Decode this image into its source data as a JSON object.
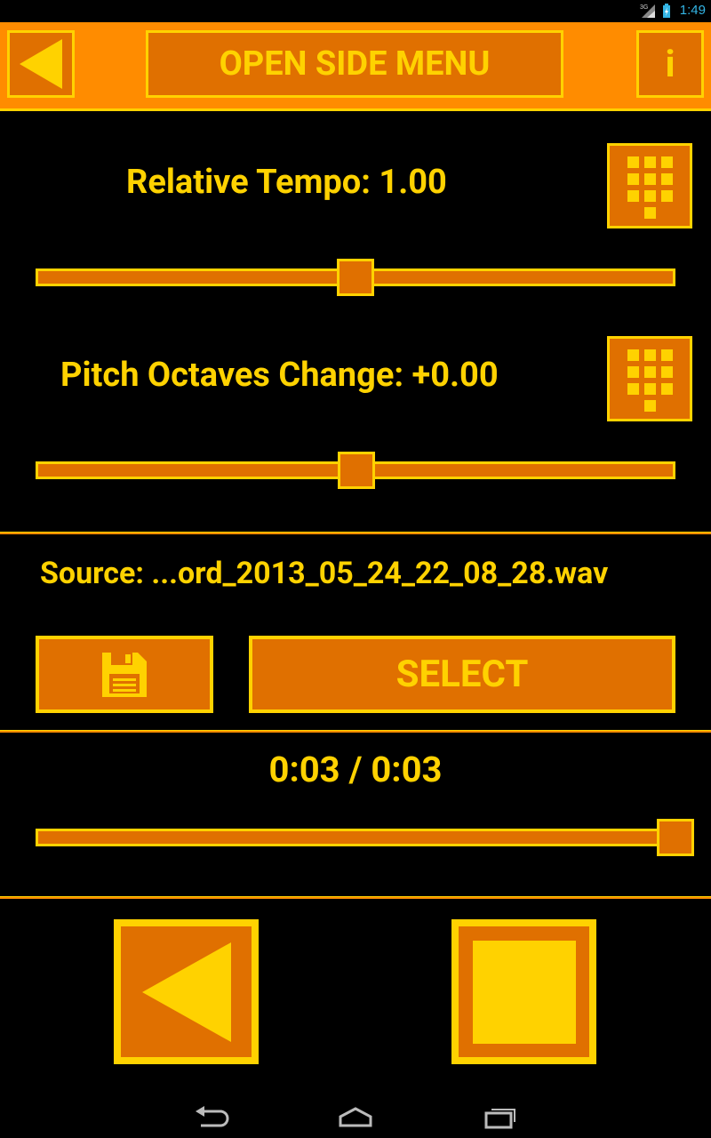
{
  "status_bar": {
    "time": "1:49",
    "network": "3G"
  },
  "top_bar": {
    "back_icon": "back-triangle-icon",
    "side_menu_label": "OPEN SIDE MENU",
    "info_label": "i"
  },
  "tempo": {
    "label": "Relative Tempo: 1.00",
    "slider_value": 0.5,
    "keypad_icon": "keypad-icon"
  },
  "pitch": {
    "label": "Pitch Octaves Change: +0.00",
    "slider_value": 0.5,
    "keypad_icon": "keypad-icon"
  },
  "source": {
    "label": "Source: ...ord_2013_05_24_22_08_28.wav",
    "save_icon": "floppy-disk-icon",
    "select_label": "SELECT"
  },
  "playback": {
    "time_label": "0:03 / 0:03",
    "progress": 1.0
  },
  "controls": {
    "play_icon": "play-reverse-icon",
    "stop_icon": "stop-icon"
  },
  "colors": {
    "accent": "#ffd200",
    "button_fill": "#e07000",
    "topbar": "#ff8c00",
    "background": "#000000",
    "status_time": "#33b5e5"
  }
}
